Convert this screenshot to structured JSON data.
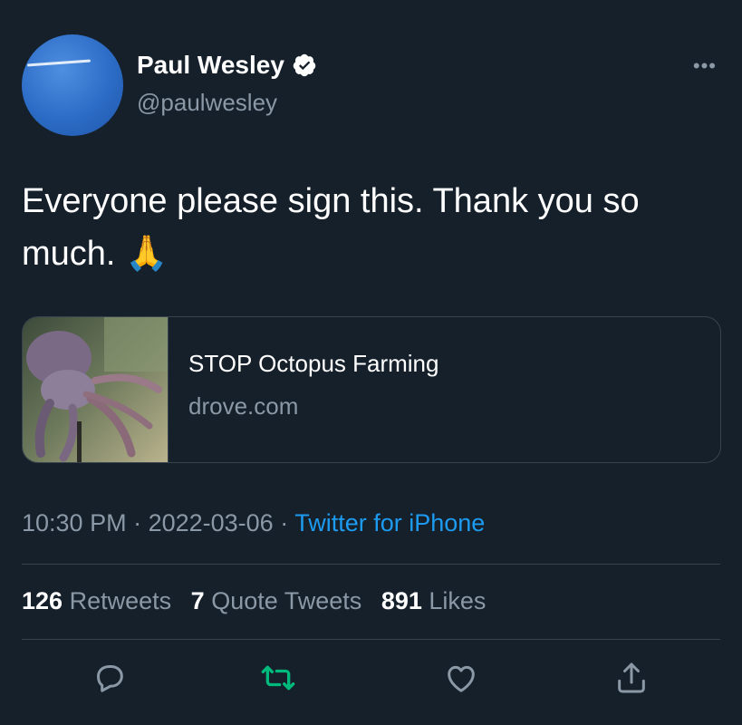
{
  "author": {
    "display_name": "Paul Wesley",
    "handle": "@paulwesley",
    "verified": true
  },
  "tweet": {
    "text": "Everyone please sign this. Thank you so much. 🙏"
  },
  "link_card": {
    "title": "STOP Octopus Farming",
    "domain": "drove.com"
  },
  "meta": {
    "time": "10:30 PM",
    "sep1": " · ",
    "date": "2022-03-06",
    "sep2": " · ",
    "source": "Twitter for iPhone"
  },
  "stats": {
    "retweets_count": "126",
    "retweets_label": "Retweets",
    "quotes_count": "7",
    "quotes_label": "Quote Tweets",
    "likes_count": "891",
    "likes_label": "Likes"
  },
  "colors": {
    "background": "#15202b",
    "link": "#1d9bf0",
    "muted": "#8b98a5",
    "retweet_green": "#00ba7c"
  },
  "icons": {
    "more": "more-icon",
    "reply": "reply-icon",
    "retweet": "retweet-icon",
    "like": "like-icon",
    "share": "share-icon",
    "verified": "verified-badge-icon"
  }
}
